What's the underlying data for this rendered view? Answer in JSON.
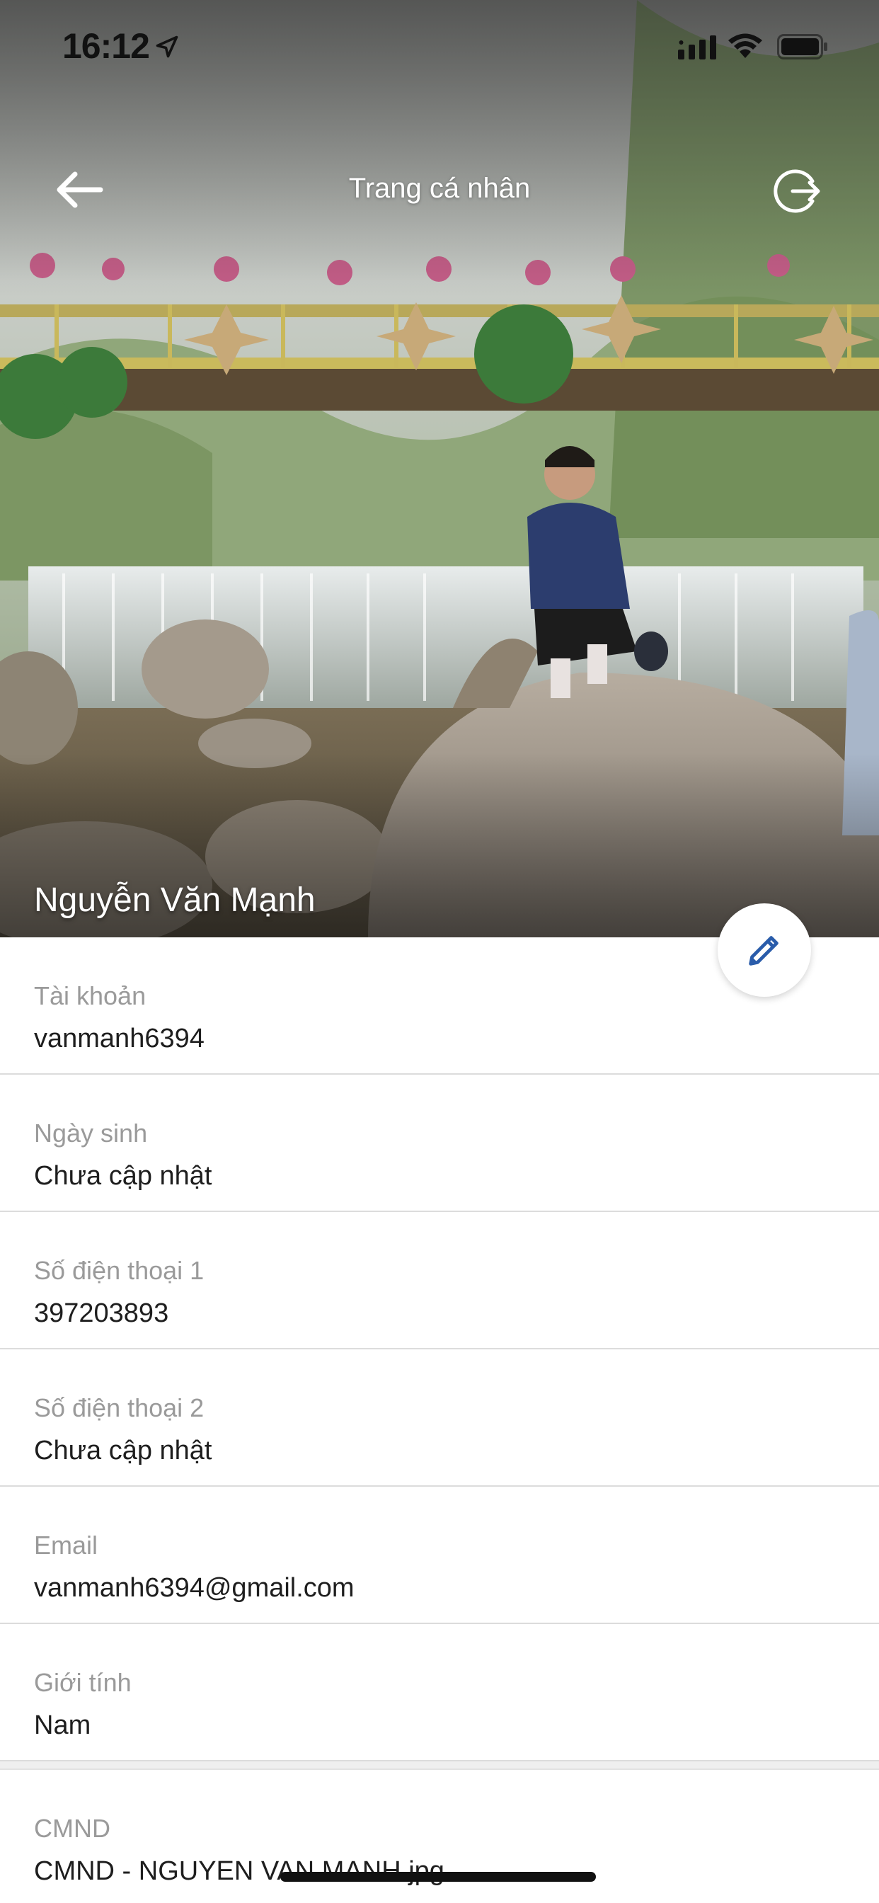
{
  "status_bar": {
    "time": "16:12"
  },
  "nav": {
    "title": "Trang cá nhân",
    "back_icon": "arrow-left-icon",
    "logout_icon": "logout-icon"
  },
  "profile": {
    "name": "Nguyễn Văn Mạnh"
  },
  "fields": [
    {
      "label": "Tài khoản",
      "value": "vanmanh6394"
    },
    {
      "label": "Ngày sinh",
      "value": "Chưa cập nhật"
    },
    {
      "label": "Số điện thoại 1",
      "value": "397203893"
    },
    {
      "label": "Số điện thoại 2",
      "value": "Chưa cập nhật"
    },
    {
      "label": "Email",
      "value": "vanmanh6394@gmail.com"
    },
    {
      "label": "Giới tính",
      "value": "Nam"
    }
  ],
  "documents": [
    {
      "label": "CMND",
      "value": "CMND - NGUYEN VAN MANH.jpg"
    }
  ],
  "colors": {
    "accent": "#2a5caa",
    "label": "#9a9a9a",
    "value": "#1e1e1e"
  }
}
